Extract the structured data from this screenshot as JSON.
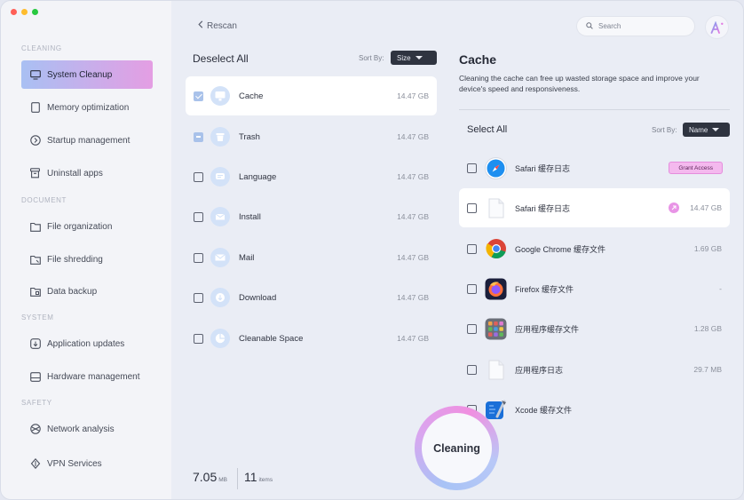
{
  "window": {
    "traffic_lights": [
      "#ff5f57",
      "#febc2e",
      "#28c840"
    ]
  },
  "sidebar": {
    "sections": [
      {
        "title": "CLEANING",
        "items": [
          {
            "label": "System Cleanup",
            "icon": "monitor-icon",
            "active": true
          },
          {
            "label": "Memory optimization",
            "icon": "memory-icon"
          },
          {
            "label": "Startup management",
            "icon": "power-icon"
          },
          {
            "label": "Uninstall apps",
            "icon": "trash-icon"
          }
        ]
      },
      {
        "title": "DOCUMENT",
        "items": [
          {
            "label": "File organization",
            "icon": "folder-icon"
          },
          {
            "label": "File shredding",
            "icon": "folder-shred-icon"
          },
          {
            "label": "Data backup",
            "icon": "folder-backup-icon"
          }
        ]
      },
      {
        "title": "SYSTEM",
        "items": [
          {
            "label": "Application updates",
            "icon": "update-icon"
          },
          {
            "label": "Hardware management",
            "icon": "hardware-icon"
          }
        ]
      },
      {
        "title": "SAFETY",
        "items": [
          {
            "label": "Network analysis",
            "icon": "network-icon"
          },
          {
            "label": "VPN Services",
            "icon": "vpn-icon"
          }
        ]
      }
    ]
  },
  "middle": {
    "rescan_label": "Rescan",
    "deselect_label": "Deselect All",
    "sort_label": "Sort By:",
    "sort_value": "Size",
    "categories": [
      {
        "name": "Cache",
        "size": "14.47 GB",
        "state": "checked",
        "icon": "cache-icon"
      },
      {
        "name": "Trash",
        "size": "14.47 GB",
        "state": "partial",
        "icon": "trash-icon"
      },
      {
        "name": "Language",
        "size": "14.47 GB",
        "state": "unchecked",
        "icon": "language-icon"
      },
      {
        "name": "Install",
        "size": "14.47 GB",
        "state": "unchecked",
        "icon": "install-icon"
      },
      {
        "name": "Mail",
        "size": "14.47 GB",
        "state": "unchecked",
        "icon": "mail-icon"
      },
      {
        "name": "Download",
        "size": "14.47 GB",
        "state": "unchecked",
        "icon": "download-icon"
      },
      {
        "name": "Cleanable Space",
        "size": "14.47 GB",
        "state": "unchecked",
        "icon": "pie-icon"
      }
    ],
    "total_value": "7.05",
    "total_unit": "MB",
    "items_count": "11",
    "items_label": "items"
  },
  "right": {
    "search_placeholder": "Search",
    "title": "Cache",
    "description": "Cleaning the cache can free up wasted storage space and improve your device's speed and responsiveness.",
    "select_all_label": "Select All",
    "sort_label": "Sort By:",
    "sort_value": "Name",
    "grant_label": "Grant Access",
    "files": [
      {
        "name": "Safari 缓存日志",
        "size": "",
        "icon": "safari-icon",
        "grant": true
      },
      {
        "name": "Safari 缓存日志",
        "size": "14.47 GB",
        "icon": "document-icon",
        "selected": true
      },
      {
        "name": "Google Chrome 缓存文件",
        "size": "1.69 GB",
        "icon": "chrome-icon"
      },
      {
        "name": "Firefox 缓存文件",
        "size": "-",
        "icon": "firefox-icon"
      },
      {
        "name": "应用程序缓存文件",
        "size": "1.28 GB",
        "icon": "app-folder-icon"
      },
      {
        "name": "应用程序日志",
        "size": "29.7 MB",
        "icon": "document-icon"
      },
      {
        "name": "Xcode 缓存文件",
        "size": "",
        "icon": "xcode-icon"
      }
    ]
  },
  "clean_button_label": "Cleaning",
  "colors": {
    "accent_from": "#a9c0f3",
    "accent_to": "#e49ee3",
    "grant_bg": "#f4b9ee"
  }
}
